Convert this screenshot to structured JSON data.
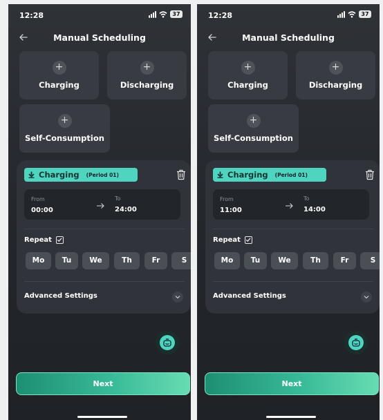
{
  "screens": [
    {
      "status": {
        "time": "12:28",
        "battery": "37"
      },
      "header": {
        "title": "Manual Scheduling"
      },
      "modes": [
        {
          "label": "Charging"
        },
        {
          "label": "Discharging"
        },
        {
          "label": "Self-Consumption"
        }
      ],
      "period": {
        "mode": "Charging",
        "period": "(Period 01)",
        "from_label": "From",
        "from_value": "00:00",
        "to_label": "To",
        "to_value": "24:00",
        "repeat_label": "Repeat",
        "repeat_checked": true,
        "days": [
          "Mo",
          "Tu",
          "We",
          "Th",
          "Fr",
          "S"
        ],
        "advanced_label": "Advanced Settings"
      },
      "next_label": "Next"
    },
    {
      "status": {
        "time": "12:28",
        "battery": "37"
      },
      "header": {
        "title": "Manual Scheduling"
      },
      "modes": [
        {
          "label": "Charging"
        },
        {
          "label": "Discharging"
        },
        {
          "label": "Self-Consumption"
        }
      ],
      "period": {
        "mode": "Charging",
        "period": "(Period 01)",
        "from_label": "From",
        "from_value": "11:00",
        "to_label": "To",
        "to_value": "14:00",
        "repeat_label": "Repeat",
        "repeat_checked": true,
        "days": [
          "Mo",
          "Tu",
          "We",
          "Th",
          "Fr",
          "S"
        ],
        "advanced_label": "Advanced Settings"
      },
      "next_label": "Next"
    }
  ],
  "colors": {
    "accent": "#4fd5bf",
    "background": "#2a2d32",
    "card": "#30333a",
    "tile": "#383b41",
    "chip": "#4a4e55"
  },
  "icons": [
    "back-arrow-icon",
    "plus-icon",
    "download-arrow-icon",
    "trash-icon",
    "right-arrow-icon",
    "checkbox-icon",
    "chevron-down-icon",
    "robot-assistant-icon",
    "signal-icon",
    "wifi-icon",
    "battery-icon"
  ]
}
